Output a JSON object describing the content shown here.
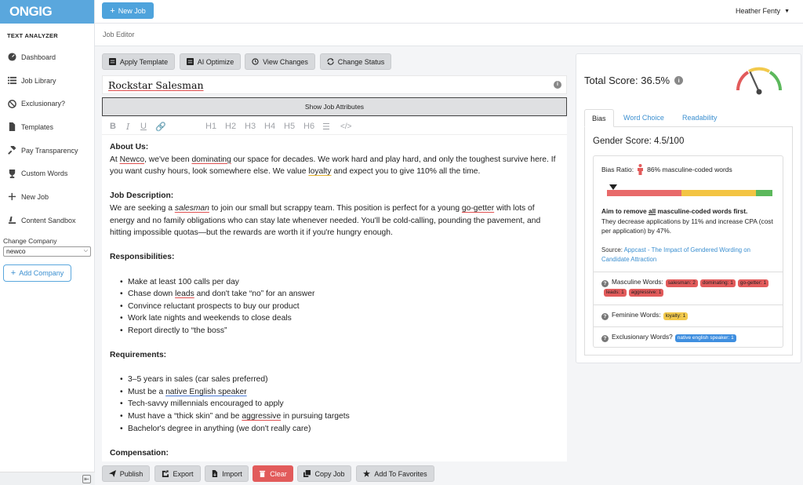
{
  "app": {
    "logo": "ONGIG",
    "accent": "#5aa7dd"
  },
  "sidebar": {
    "section_title": "TEXT ANALYZER",
    "items": [
      {
        "label": "Dashboard",
        "icon": "dashboard-icon"
      },
      {
        "label": "Job Library",
        "icon": "list-icon"
      },
      {
        "label": "Exclusionary?",
        "icon": "ban-icon"
      },
      {
        "label": "Templates",
        "icon": "file-icon"
      },
      {
        "label": "Pay Transparency",
        "icon": "gavel-icon"
      },
      {
        "label": "Custom Words",
        "icon": "trophy-icon"
      },
      {
        "label": "New Job",
        "icon": "plus-icon"
      },
      {
        "label": "Content Sandbox",
        "icon": "sandbox-icon"
      }
    ],
    "change_company_label": "Change Company",
    "company_value": "newco",
    "add_company_label": "Add Company"
  },
  "topbar": {
    "new_job_label": "New Job",
    "user_name": "Heather Fenty"
  },
  "breadcrumb": "Job Editor",
  "toolbar": {
    "apply_template": "Apply Template",
    "ai_optimize": "AI Optimize",
    "view_changes": "View Changes",
    "change_status": "Change Status"
  },
  "editor": {
    "title": "Rockstar Salesman",
    "show_attributes": "Show Job Attributes",
    "format_buttons": [
      "B",
      "I",
      "U",
      "H1",
      "H2",
      "H3",
      "H4",
      "H5",
      "H6"
    ],
    "about_heading": "About Us:",
    "about_1": "At ",
    "about_newco": "Newco",
    "about_2": ", we've been ",
    "about_dominating": "dominating",
    "about_3": " our space for decades. We work hard and play hard, and only the toughest survive here. If you want cushy hours, look somewhere else. We value ",
    "about_loyalty": "loyalty",
    "about_4": " and expect you to give 110% all the time.",
    "desc_heading": "Job Description:",
    "desc_1": "We are seeking a ",
    "desc_salesman": "salesman",
    "desc_2": " to join our small but scrappy team. This position is perfect for a young ",
    "desc_gogetter": "go-getter",
    "desc_3": " with lots of energy and no family obligations who can stay late whenever needed. You'll be cold-calling, pounding the pavement, and hitting impossible quotas—but the rewards are worth it if you're hungry enough.",
    "resp_heading": "Responsibilities:",
    "resp_1": "Make at least 100 calls per day",
    "resp_2a": "Chase down ",
    "resp_2_leads": "leads",
    "resp_2b": " and don't take “no” for an answer",
    "resp_3": "Convince reluctant prospects to buy our product",
    "resp_4": "Work late nights and weekends to close deals",
    "resp_5": "Report directly to “the boss”",
    "req_heading": "Requirements:",
    "req_1": "3–5 years in sales (car sales preferred)",
    "req_2a": "Must be a ",
    "req_2_native": "native English speaker",
    "req_3": "Tech-savvy millennials encouraged to apply",
    "req_4a": "Must have a “thick skin” and be ",
    "req_4_aggr": "aggressive",
    "req_4b": " in pursuing targets",
    "req_5": "Bachelor's degree in anything (we don't really care)",
    "comp_heading": "Compensation:"
  },
  "bottom_bar": {
    "publish": "Publish",
    "export": "Export",
    "import": "Import",
    "clear": "Clear",
    "copy_job": "Copy Job",
    "favorites": "Add To Favorites"
  },
  "score_panel": {
    "total_score": "Total Score: 36.5%",
    "gauge_score": 0.365,
    "tabs": [
      "Bias",
      "Word Choice",
      "Readability"
    ],
    "gender_score": "Gender Score: 4.5/100",
    "bias_ratio_label": "Bias Ratio:",
    "bias_ratio_value": "86% masculine-coded words",
    "bias_marker_position": 0.04,
    "bias_bar_segments": [
      {
        "share": 0.45,
        "color": "#e86a6a"
      },
      {
        "share": 0.45,
        "color": "#f3c443"
      },
      {
        "share": 0.1,
        "color": "#5cb85c"
      }
    ],
    "aim_1": "Aim to remove ",
    "aim_all": "all",
    "aim_2": " masculine-coded words first.",
    "aim_body": "They decrease applications by 11% and increase CPA (cost per application) by 47%.",
    "source_label": "Source: ",
    "source_link": "Appcast - The Impact of Gendered Wording on Candidate Attraction",
    "masculine_label": "Masculine Words:",
    "masculine_badges": [
      "salesman: 2",
      "dominating: 1",
      "go-getter: 1",
      "leads: 1",
      "aggressive: 1"
    ],
    "feminine_label": "Feminine Words:",
    "feminine_badges": [
      "loyalty: 1"
    ],
    "exclusionary_label": "Exclusionary Words?",
    "exclusionary_badges": [
      "native english speaker: 1"
    ]
  }
}
